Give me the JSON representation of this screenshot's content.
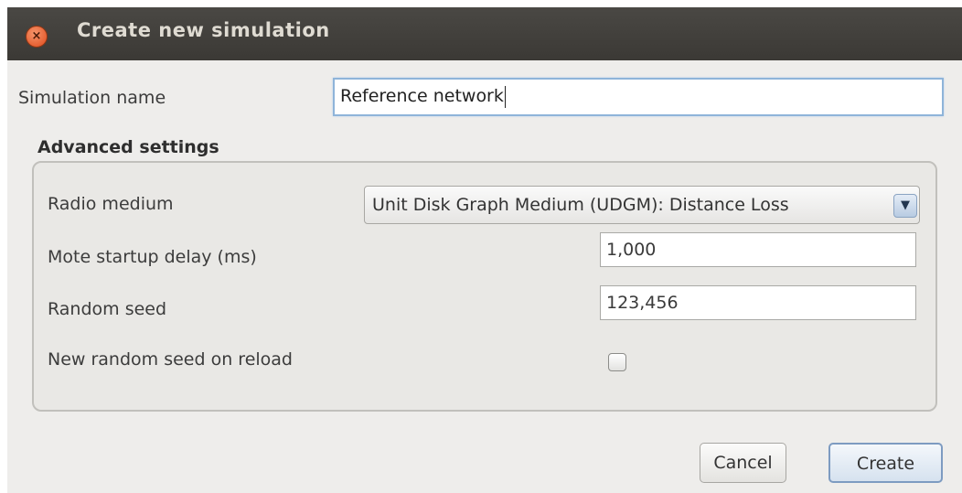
{
  "window": {
    "title": "Create new simulation",
    "close_icon_glyph": "×"
  },
  "form": {
    "name_label": "Simulation name",
    "name_value": "Reference network"
  },
  "advanced": {
    "title": "Advanced settings",
    "radio_medium_label": "Radio medium",
    "radio_medium_value": "Unit Disk Graph Medium (UDGM): Distance Loss",
    "dropdown_arrow_glyph": "▼",
    "startup_delay_label": "Mote startup delay (ms)",
    "startup_delay_value": "1,000",
    "random_seed_label": "Random seed",
    "random_seed_value": "123,456",
    "new_seed_label": "New random seed on reload",
    "new_seed_checked": false
  },
  "buttons": {
    "cancel_label": "Cancel",
    "create_label": "Create"
  },
  "colors": {
    "titlebar": "#3f3d39",
    "dialog_bg": "#eeedeb",
    "focus_border": "#8fb4d9",
    "close_button": "#e45a26"
  }
}
